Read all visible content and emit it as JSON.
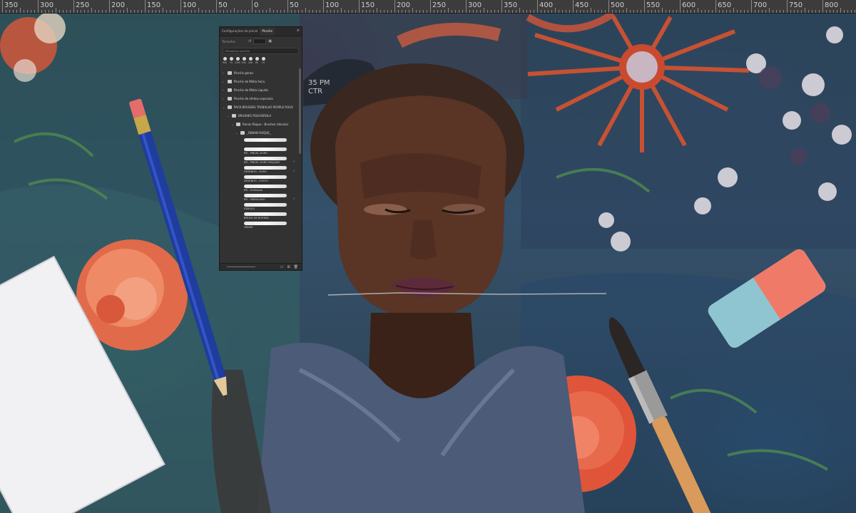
{
  "ruler": {
    "labels": [
      "350",
      "300",
      "250",
      "200",
      "150",
      "100",
      "50",
      "0",
      "50",
      "100",
      "150",
      "200",
      "250",
      "300",
      "350",
      "400",
      "450",
      "500",
      "550",
      "600",
      "650",
      "700",
      "750",
      "800"
    ]
  },
  "brush_panel": {
    "tabs": [
      "Configurações do pincel",
      "Pincéis"
    ],
    "active_tab": "Pincéis",
    "size_label": "Tamanho:",
    "search_placeholder": "Pesquisar pincéis",
    "presets": [
      "900",
      "75",
      "1200",
      "500",
      "246",
      "60",
      "25"
    ],
    "groups": [
      {
        "label": "Pincéis gerais",
        "expanded": false
      },
      {
        "label": "Pincéis de Mídia Seca",
        "expanded": false
      },
      {
        "label": "Pincéis de Mídia Líquida",
        "expanded": false
      },
      {
        "label": "Pincéis de efeitos especiais",
        "expanded": false
      },
      {
        "label": "PACK BRUSHES TRABALHO PEOPLE ROUX",
        "expanded": true
      },
      {
        "label": "BRUSHES POLIVOROLA",
        "expanded": true
      },
      {
        "label": "Renan Roque - Brushes (decolo)",
        "expanded": true
      },
      {
        "label": "_RENAN ROQUE_",
        "expanded": true
      }
    ],
    "brushes": [
      "",
      "RR - PINCEL DURO",
      "RR - PINCEL DURO MAÇADO",
      "DESENHO - DURO",
      "DESENHO - EFEITO",
      "RR - Ondulado",
      "RR - ONDULADO",
      "ESBOÇO",
      "BRUSH DE BORRAR",
      "GRADE"
    ]
  },
  "artwork": {
    "clock_text_1": "35 PM",
    "clock_text_2": "CTR"
  },
  "colors": {
    "accent_orange": "#e0603e",
    "ui_dark": "#323232",
    "ruler_bg": "#3c3c3c"
  }
}
